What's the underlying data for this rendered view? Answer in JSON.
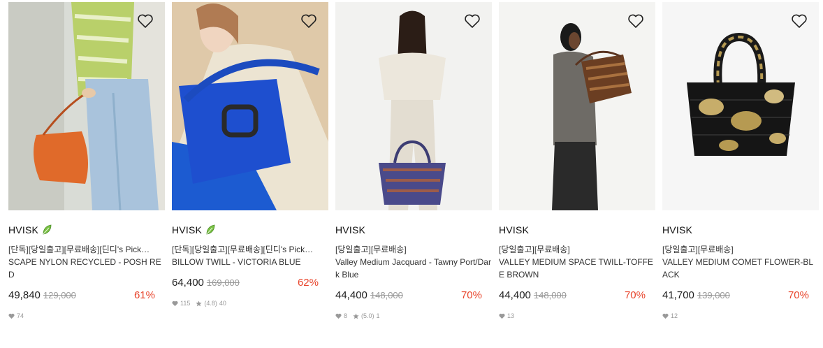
{
  "products": [
    {
      "brand": "HVISK",
      "eco": true,
      "tags": "[단독][당일출고][무료배송][딘디's Pick…",
      "name": "SCAPE NYLON RECYCLED - POSH RED",
      "price": "49,840",
      "original_price": "129,000",
      "discount": "61%",
      "likes": "74",
      "rating": "",
      "reviews": ""
    },
    {
      "brand": "HVISK",
      "eco": true,
      "tags": "[단독][당일출고][무료배송][딘디's Pick…",
      "name": "BILLOW TWILL - VICTORIA BLUE",
      "price": "64,400",
      "original_price": "169,000",
      "discount": "62%",
      "likes": "115",
      "rating": "(4.8)",
      "reviews": "40"
    },
    {
      "brand": "HVISK",
      "eco": false,
      "tags": "[당일출고][무료배송]",
      "name": "Valley Medium Jacquard - Tawny Port/Dark Blue",
      "price": "44,400",
      "original_price": "148,000",
      "discount": "70%",
      "likes": "8",
      "rating": "(5.0)",
      "reviews": "1"
    },
    {
      "brand": "HVISK",
      "eco": false,
      "tags": "[당일출고][무료배송]",
      "name": "VALLEY MEDIUM SPACE TWILL-TOFFEE BROWN",
      "price": "44,400",
      "original_price": "148,000",
      "discount": "70%",
      "likes": "13",
      "rating": "",
      "reviews": ""
    },
    {
      "brand": "HVISK",
      "eco": false,
      "tags": "[당일출고][무료배송]",
      "name": "VALLEY MEDIUM COMET FLOWER-BLACK",
      "price": "41,700",
      "original_price": "139,000",
      "discount": "70%",
      "likes": "12",
      "rating": "",
      "reviews": ""
    }
  ],
  "colors": {
    "discount": "#e8452c",
    "eco_leaf": "#4caf50",
    "muted": "#999999"
  },
  "icons": {
    "wishlist": "heart-outline-icon",
    "eco": "leaf-icon",
    "likes": "heart-icon",
    "rating": "star-icon"
  }
}
